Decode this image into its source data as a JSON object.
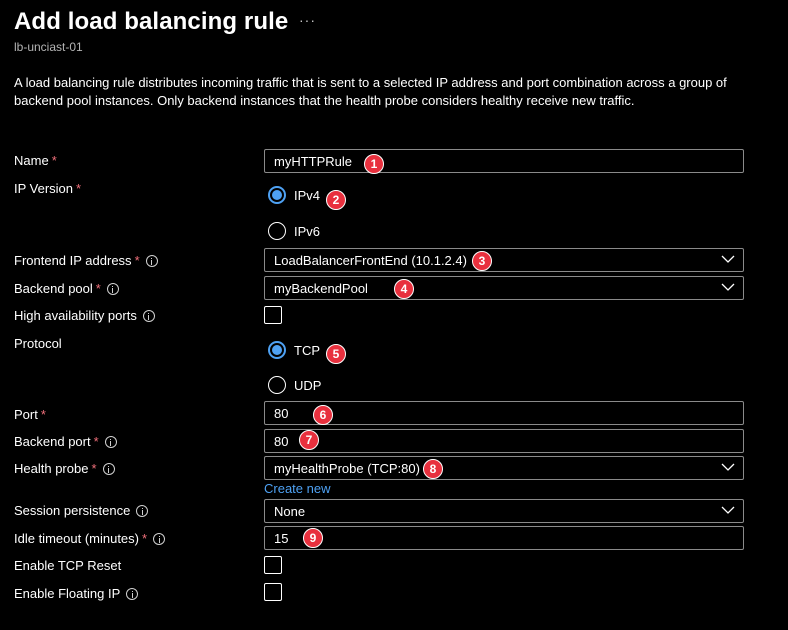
{
  "header": {
    "title": "Add load balancing rule",
    "more_icon": "ellipsis-icon",
    "more_label": "···",
    "subtitle": "lb-unciast-01"
  },
  "description": "A load balancing rule distributes incoming traffic that is sent to a selected IP address and port combination across a group of backend pool instances. Only backend instances that the health probe considers healthy receive new traffic.",
  "form": {
    "name": {
      "label": "Name",
      "required_mark": "*",
      "value": "myHTTPRule"
    },
    "ip_version": {
      "label": "IP Version",
      "required_mark": "*",
      "options": [
        "IPv4",
        "IPv6"
      ],
      "selected": "IPv4"
    },
    "frontend_ip": {
      "label": "Frontend IP address",
      "required_mark": "*",
      "value": "LoadBalancerFrontEnd (10.1.2.4)"
    },
    "backend_pool": {
      "label": "Backend pool",
      "required_mark": "*",
      "value": "myBackendPool"
    },
    "ha_ports": {
      "label": "High availability ports",
      "checked": false
    },
    "protocol": {
      "label": "Protocol",
      "options": [
        "TCP",
        "UDP"
      ],
      "selected": "TCP"
    },
    "port": {
      "label": "Port",
      "required_mark": "*",
      "value": "80"
    },
    "backend_port": {
      "label": "Backend port",
      "required_mark": "*",
      "value": "80"
    },
    "health_probe": {
      "label": "Health probe",
      "required_mark": "*",
      "value": "myHealthProbe (TCP:80)",
      "create_new_label": "Create new"
    },
    "session_persistence": {
      "label": "Session persistence",
      "value": "None"
    },
    "idle_timeout": {
      "label": "Idle timeout (minutes)",
      "required_mark": "*",
      "value": "15"
    },
    "tcp_reset": {
      "label": "Enable TCP Reset",
      "checked": false
    },
    "floating_ip": {
      "label": "Enable Floating IP",
      "checked": false
    }
  },
  "badges": [
    "1",
    "2",
    "3",
    "4",
    "5",
    "6",
    "7",
    "8",
    "9"
  ],
  "colors": {
    "background": "#000000",
    "accent": "#4ea1f3",
    "required": "#f1707b",
    "badge": "#e8303e",
    "border": "#8a8a8a"
  }
}
